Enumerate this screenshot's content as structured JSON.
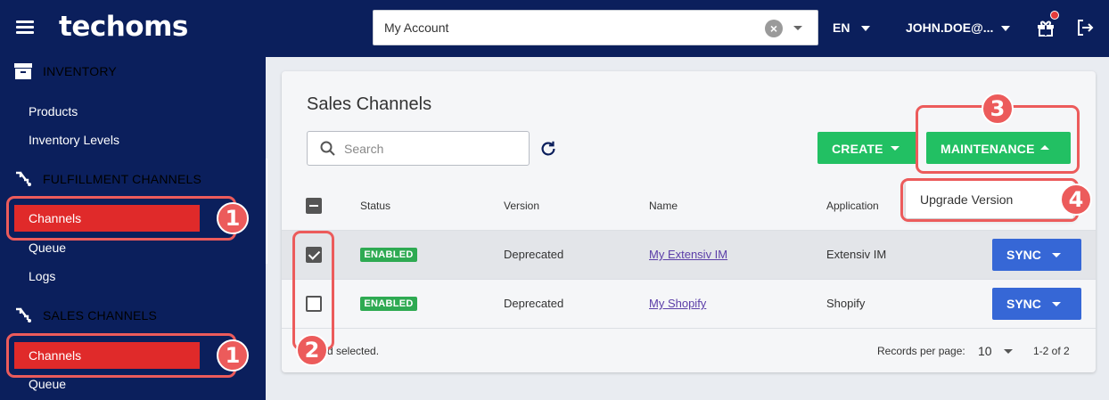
{
  "header": {
    "logo": "techoms",
    "account_value": "My Account",
    "language": "EN",
    "user": "JOHN.DOE@..."
  },
  "sidebar": {
    "sections": [
      {
        "label": "INVENTORY",
        "items": [
          "Products",
          "Inventory Levels"
        ]
      },
      {
        "label": "FULFILLMENT CHANNELS",
        "items": [
          "Channels",
          "Queue",
          "Logs"
        ]
      },
      {
        "label": "SALES CHANNELS",
        "items": [
          "Channels",
          "Queue"
        ]
      }
    ]
  },
  "main": {
    "title": "Sales Channels",
    "search_placeholder": "Search",
    "create_label": "CREATE",
    "maintenance_label": "MAINTENANCE",
    "dropdown_item": "Upgrade Version",
    "columns": [
      "Status",
      "Version",
      "Name",
      "Application"
    ],
    "rows": [
      {
        "status": "ENABLED",
        "version": "Deprecated",
        "name": "My Extensiv IM",
        "application": "Extensiv IM",
        "checked": true,
        "action": "SYNC"
      },
      {
        "status": "ENABLED",
        "version": "Deprecated",
        "name": "My Shopify",
        "application": "Shopify",
        "checked": false,
        "action": "SYNC"
      }
    ],
    "footer_selected": "d selected.",
    "records_per_page_label": "Records per page:",
    "records_per_page_value": "10",
    "range": "1-2 of 2"
  },
  "annotations": [
    "1",
    "1",
    "2",
    "3",
    "4"
  ],
  "colors": {
    "nav": "#0b1f5c",
    "highlight": "#e02a2a",
    "annotation": "#ec5b5b",
    "green": "#22c063",
    "blue": "#3667d6"
  }
}
